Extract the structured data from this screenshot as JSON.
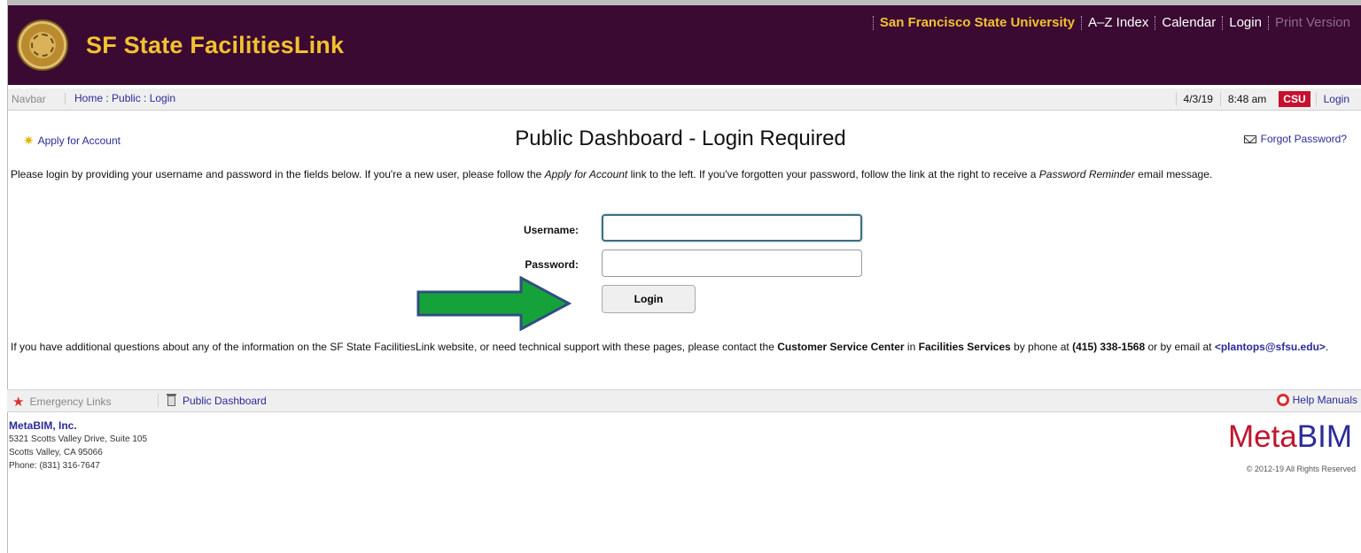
{
  "header": {
    "title": "SF State FacilitiesLink",
    "links": [
      "San Francisco State University",
      "A–Z Index",
      "Calendar",
      "Login",
      "Print Version"
    ]
  },
  "navbar": {
    "label": "Navbar",
    "breadcrumb": "Home : Public : Login",
    "date": "4/3/19",
    "time": "8:48 am",
    "csu_badge": "CSU",
    "login": "Login"
  },
  "main": {
    "apply_link": "Apply for Account",
    "title": "Public Dashboard - Login Required",
    "forgot_link": "Forgot Password?",
    "intro_part1": "Please login by providing your username and password in the fields below. If you're a new user, please follow the ",
    "intro_apply": "Apply for Account",
    "intro_part2": " link to the left. If you've forgotten your password, follow the link at the right to receive a ",
    "intro_reminder": "Password Reminder",
    "intro_part3": " email message.",
    "username_label": "Username:",
    "username_value": "",
    "password_label": "Password:",
    "password_value": "",
    "login_button": "Login",
    "contact_part1": "If you have additional questions about any of the information on the SF State FacilitiesLink website, or need technical support with these pages, please contact the ",
    "contact_center": "Customer Service Center",
    "contact_part2": " in ",
    "contact_services": "Facilities Services",
    "contact_part3": " by phone at ",
    "contact_phone": "(415) 338-1568",
    "contact_part4": " or by email at ",
    "contact_email": "<plantops@sfsu.edu>",
    "contact_part5": "."
  },
  "footer": {
    "emergency": "Emergency Links",
    "public_dashboard": "Public Dashboard",
    "help": "Help Manuals",
    "vendor_name": "MetaBIM, Inc.",
    "vendor_address1": "5321 Scotts Valley Drive, Suite 105",
    "vendor_address2": "Scotts Valley, CA 95066",
    "vendor_phone": "Phone: (831) 316-7647",
    "logo_meta": "Meta",
    "logo_bim": "BIM",
    "copyright": "© 2012-19 All Rights Reserved"
  },
  "colors": {
    "header_bg": "#3a0a33",
    "title_gold": "#f2c230",
    "link_blue": "#2b2b9a",
    "arrow_green": "#16a23a",
    "csu_red": "#c8102e"
  },
  "icons": [
    "seal-logo",
    "star-icon",
    "mail-icon",
    "arrow-icon",
    "emergency-icon",
    "trash-icon",
    "lifebuoy-icon"
  ]
}
